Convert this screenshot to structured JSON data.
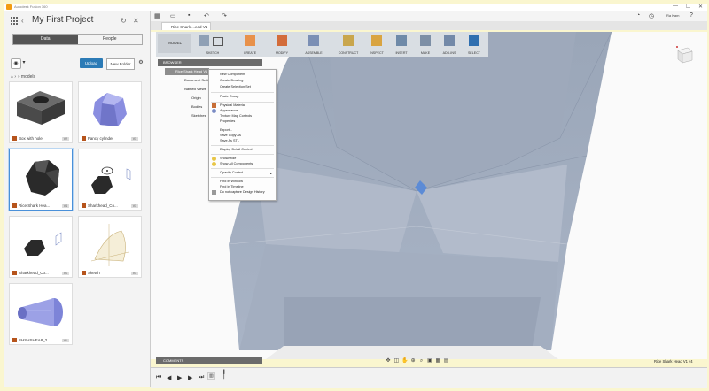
{
  "window": {
    "title": "Autodesk Fusion 360",
    "controls": [
      "—",
      "☐",
      "✕"
    ]
  },
  "data_panel": {
    "project_title": "My First Project",
    "tabs": [
      {
        "label": "Data",
        "active": true
      },
      {
        "label": "People",
        "active": false
      }
    ],
    "upload_label": "Upload",
    "new_folder_label": "New Folder",
    "breadcrumb": "models",
    "items": [
      {
        "label": "Box with hole",
        "version": "V2"
      },
      {
        "label": "Fancy cylinder",
        "version": "V1"
      },
      {
        "label": "Rice Shark Hea...",
        "version": "V4"
      },
      {
        "label": "Sharkhead_Co...",
        "version": "V1"
      },
      {
        "label": "Sharkhead_Co...",
        "version": "V1"
      },
      {
        "label": "Sketch",
        "version": "V1"
      },
      {
        "label": "SHSHSHEA8_2...",
        "version": "V1"
      }
    ]
  },
  "toolbar": {
    "user_name": "Ra Kam",
    "doc_tab": "Rice Shark ...ead V1 v4",
    "workspace": "MODEL",
    "groups": [
      "SKETCH",
      "CREATE",
      "MODIFY",
      "ASSEMBLE",
      "CONSTRUCT",
      "INSPECT",
      "INSERT",
      "MAKE",
      "ADD-INS",
      "SELECT"
    ]
  },
  "browser": {
    "title": "BROWSER",
    "root": "Rice Shark Head V1 v4",
    "rows": [
      "Document Settings",
      "Named Views",
      "Origin",
      "Bodies",
      "Sketches"
    ]
  },
  "context_menu": {
    "items": [
      "New Component",
      "Create Drawing",
      "Create Selection Set",
      "Paste Group",
      "Physical Material",
      "Appearance",
      "Texture Map Controls",
      "Properties",
      "Export...",
      "Save Copy As",
      "Save As STL",
      "Display Detail Control",
      "Show/Hide",
      "Show All Components",
      "Opacity Control",
      "Find in Window",
      "Find in Timeline",
      "Do not capture Design History"
    ]
  },
  "bottom": {
    "comments_label": "COMMENTS",
    "status_name": "Rice Shark Head V1 v4"
  },
  "colors": {
    "accent": "#2c7bb6",
    "model": "#9aa7bf",
    "frame": "#faf6cf"
  }
}
